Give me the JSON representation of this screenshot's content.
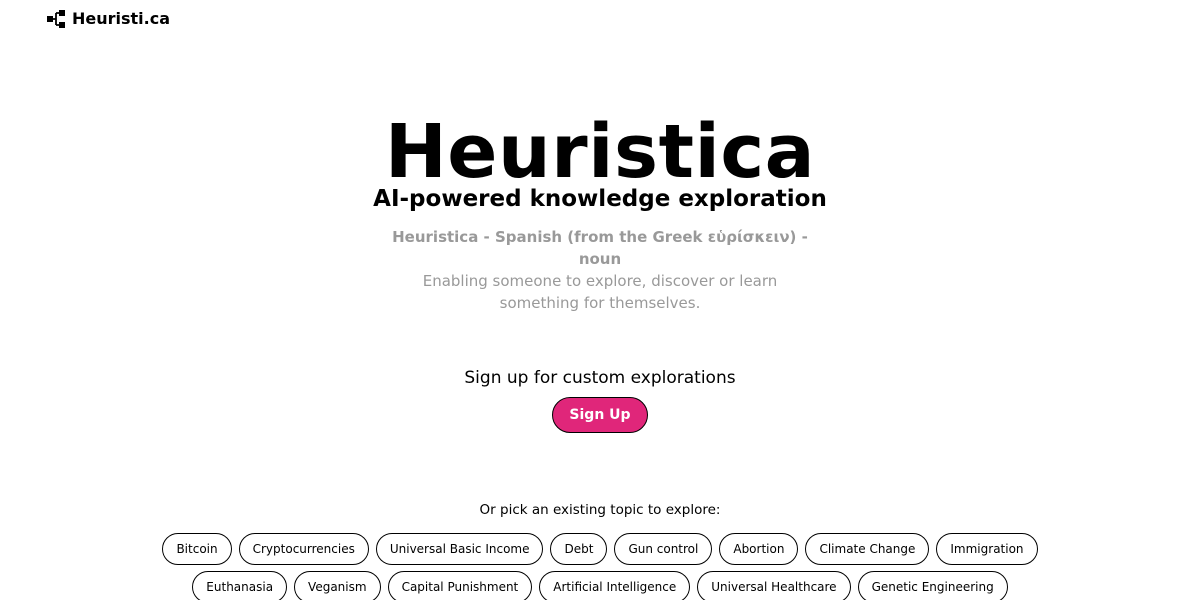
{
  "header": {
    "brand_name": "Heuristi.ca",
    "brand_icon": "sitemap-icon"
  },
  "hero": {
    "title": "Heuristica",
    "subtitle": "AI-powered knowledge exploration",
    "definition_term": "Heuristica - Spanish (from the Greek εὑρίσκειν) - noun",
    "definition_text": "Enabling someone to explore, discover or learn something for themselves."
  },
  "signup": {
    "prompt": "Sign up for custom explorations",
    "button_label": "Sign Up",
    "button_color": "#e0267a"
  },
  "topics": {
    "prompt": "Or pick an existing topic to explore:",
    "row1": [
      {
        "label": "Bitcoin"
      },
      {
        "label": "Cryptocurrencies"
      },
      {
        "label": "Universal Basic Income"
      },
      {
        "label": "Debt"
      },
      {
        "label": "Gun control"
      },
      {
        "label": "Abortion"
      },
      {
        "label": "Climate Change"
      },
      {
        "label": "Immigration"
      }
    ],
    "row2": [
      {
        "label": "Euthanasia"
      },
      {
        "label": "Veganism"
      },
      {
        "label": "Capital Punishment"
      },
      {
        "label": "Artificial Intelligence"
      },
      {
        "label": "Universal Healthcare"
      },
      {
        "label": "Genetic Engineering"
      }
    ]
  }
}
